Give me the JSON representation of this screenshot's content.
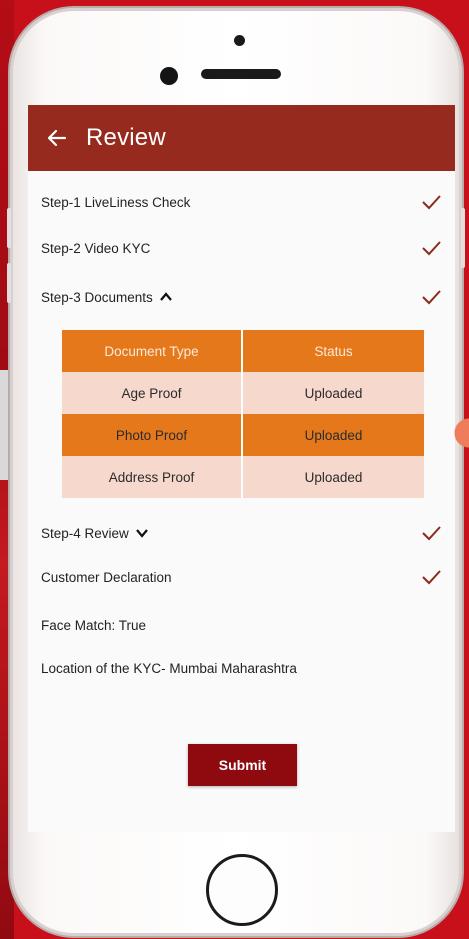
{
  "appbar": {
    "title": "Review",
    "color": "#962a1e"
  },
  "steps": [
    {
      "label": "Step-1 LiveLiness Check",
      "checked": true
    },
    {
      "label": "Step-2 Video KYC",
      "checked": true
    },
    {
      "label": "Step-3 Documents",
      "checked": true,
      "expanded": true
    },
    {
      "label": "Step-4 Review",
      "checked": true,
      "expanded": false
    },
    {
      "label": "Customer Declaration",
      "checked": true
    }
  ],
  "documents_table": {
    "headers": [
      "Document Type",
      "Status"
    ],
    "rows": [
      {
        "type": "Age Proof",
        "status": "Uploaded"
      },
      {
        "type": "Photo Proof",
        "status": "Uploaded"
      },
      {
        "type": "Address Proof",
        "status": "Uploaded"
      }
    ]
  },
  "face_match": "Face Match:  True",
  "location": "Location of the KYC-  Mumbai Maharashtra",
  "submit_label": "Submit",
  "colors": {
    "accent": "#962a1e",
    "table_header": "#e6781c",
    "table_light": "#f6d8cd",
    "submit": "#8e0a0f",
    "check": "#8a2a1e"
  },
  "icons": {
    "back": "arrow-left-icon",
    "check": "checkmark-icon",
    "chevron_up": "chevron-up-icon",
    "chevron_down": "chevron-down-icon"
  }
}
